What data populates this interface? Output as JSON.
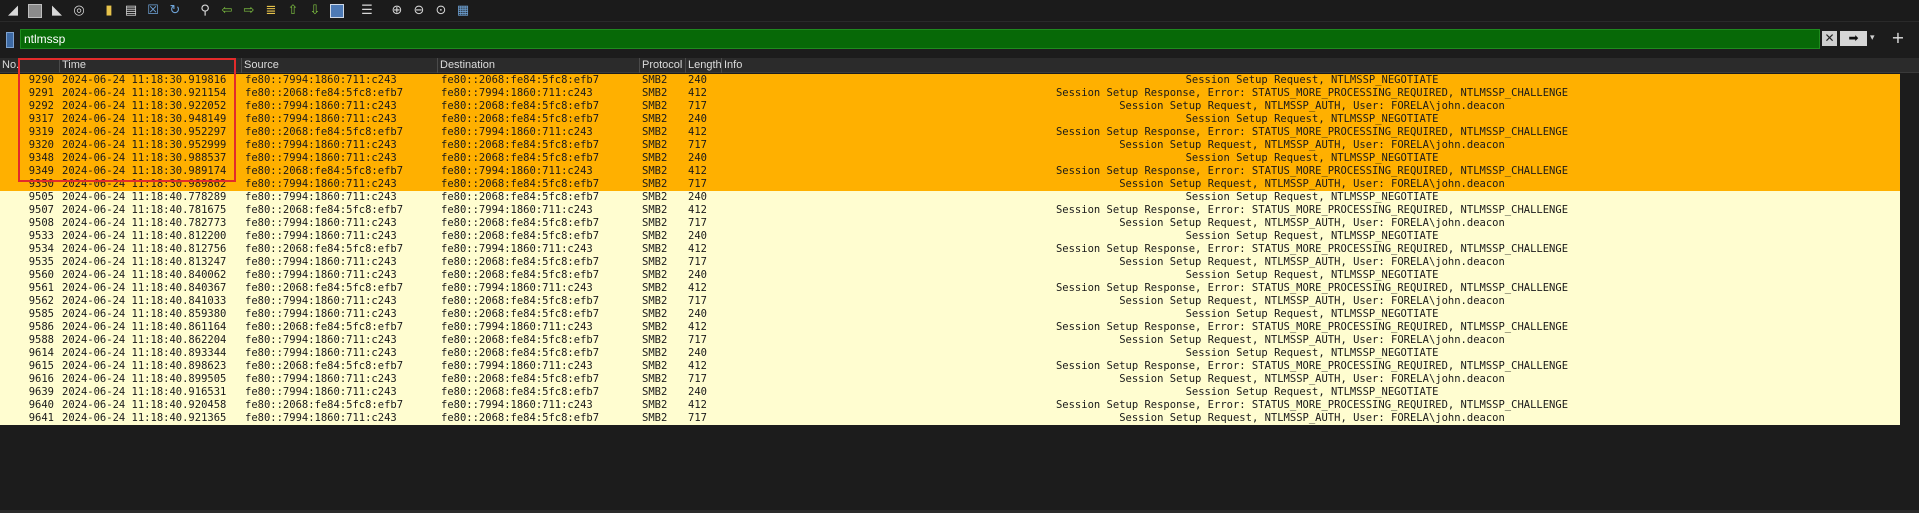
{
  "toolbar": {
    "icons": [
      "shark-fin-icon",
      "stop-icon",
      "restart-icon",
      "options-icon",
      "open-file-icon",
      "save-file-icon",
      "close-file-icon",
      "reload-icon",
      "find-icon",
      "back-arrow-icon",
      "forward-arrow-icon",
      "go-to-packet-icon",
      "first-packet-icon",
      "last-packet-icon",
      "autoscroll-icon",
      "colorize-icon",
      "zoom-in-icon",
      "zoom-out-icon",
      "normal-size-icon",
      "resize-columns-icon"
    ]
  },
  "filter": {
    "value": "ntlmssp",
    "clear_glyph": "✕",
    "apply_glyph": "➡",
    "dropdown_glyph": "▾",
    "add_glyph": "+"
  },
  "columns": {
    "no": "No.",
    "time": "Time",
    "source": "Source",
    "destination": "Destination",
    "protocol": "Protocol",
    "length": "Length",
    "info": "Info"
  },
  "colors": {
    "highlight_row": "#ffb000",
    "normal_row": "#fffdd0",
    "filter_bg": "#076907",
    "annotation_box": "#e22b2b"
  },
  "packets": [
    {
      "no": "9290",
      "time": "2024-06-24 11:18:30.919816",
      "src": "fe80::7994:1860:711:c243",
      "dst": "fe80::2068:fe84:5fc8:efb7",
      "proto": "SMB2",
      "len": "240",
      "info": "Session Setup Request, NTLMSSP_NEGOTIATE",
      "hl": true
    },
    {
      "no": "9291",
      "time": "2024-06-24 11:18:30.921154",
      "src": "fe80::2068:fe84:5fc8:efb7",
      "dst": "fe80::7994:1860:711:c243",
      "proto": "SMB2",
      "len": "412",
      "info": "Session Setup Response, Error: STATUS_MORE_PROCESSING_REQUIRED, NTLMSSP_CHALLENGE",
      "hl": true
    },
    {
      "no": "9292",
      "time": "2024-06-24 11:18:30.922052",
      "src": "fe80::7994:1860:711:c243",
      "dst": "fe80::2068:fe84:5fc8:efb7",
      "proto": "SMB2",
      "len": "717",
      "info": "Session Setup Request, NTLMSSP_AUTH, User: FORELA\\john.deacon",
      "hl": true
    },
    {
      "no": "9317",
      "time": "2024-06-24 11:18:30.948149",
      "src": "fe80::7994:1860:711:c243",
      "dst": "fe80::2068:fe84:5fc8:efb7",
      "proto": "SMB2",
      "len": "240",
      "info": "Session Setup Request, NTLMSSP_NEGOTIATE",
      "hl": true
    },
    {
      "no": "9319",
      "time": "2024-06-24 11:18:30.952297",
      "src": "fe80::2068:fe84:5fc8:efb7",
      "dst": "fe80::7994:1860:711:c243",
      "proto": "SMB2",
      "len": "412",
      "info": "Session Setup Response, Error: STATUS_MORE_PROCESSING_REQUIRED, NTLMSSP_CHALLENGE",
      "hl": true
    },
    {
      "no": "9320",
      "time": "2024-06-24 11:18:30.952999",
      "src": "fe80::7994:1860:711:c243",
      "dst": "fe80::2068:fe84:5fc8:efb7",
      "proto": "SMB2",
      "len": "717",
      "info": "Session Setup Request, NTLMSSP_AUTH, User: FORELA\\john.deacon",
      "hl": true
    },
    {
      "no": "9348",
      "time": "2024-06-24 11:18:30.988537",
      "src": "fe80::7994:1860:711:c243",
      "dst": "fe80::2068:fe84:5fc8:efb7",
      "proto": "SMB2",
      "len": "240",
      "info": "Session Setup Request, NTLMSSP_NEGOTIATE",
      "hl": true
    },
    {
      "no": "9349",
      "time": "2024-06-24 11:18:30.989174",
      "src": "fe80::2068:fe84:5fc8:efb7",
      "dst": "fe80::7994:1860:711:c243",
      "proto": "SMB2",
      "len": "412",
      "info": "Session Setup Response, Error: STATUS_MORE_PROCESSING_REQUIRED, NTLMSSP_CHALLENGE",
      "hl": true
    },
    {
      "no": "9350",
      "time": "2024-06-24 11:18:30.989862",
      "src": "fe80::7994:1860:711:c243",
      "dst": "fe80::2068:fe84:5fc8:efb7",
      "proto": "SMB2",
      "len": "717",
      "info": "Session Setup Request, NTLMSSP_AUTH, User: FORELA\\john.deacon",
      "hl": true
    },
    {
      "no": "9505",
      "time": "2024-06-24 11:18:40.778289",
      "src": "fe80::7994:1860:711:c243",
      "dst": "fe80::2068:fe84:5fc8:efb7",
      "proto": "SMB2",
      "len": "240",
      "info": "Session Setup Request, NTLMSSP_NEGOTIATE",
      "hl": false
    },
    {
      "no": "9507",
      "time": "2024-06-24 11:18:40.781675",
      "src": "fe80::2068:fe84:5fc8:efb7",
      "dst": "fe80::7994:1860:711:c243",
      "proto": "SMB2",
      "len": "412",
      "info": "Session Setup Response, Error: STATUS_MORE_PROCESSING_REQUIRED, NTLMSSP_CHALLENGE",
      "hl": false
    },
    {
      "no": "9508",
      "time": "2024-06-24 11:18:40.782773",
      "src": "fe80::7994:1860:711:c243",
      "dst": "fe80::2068:fe84:5fc8:efb7",
      "proto": "SMB2",
      "len": "717",
      "info": "Session Setup Request, NTLMSSP_AUTH, User: FORELA\\john.deacon",
      "hl": false
    },
    {
      "no": "9533",
      "time": "2024-06-24 11:18:40.812200",
      "src": "fe80::7994:1860:711:c243",
      "dst": "fe80::2068:fe84:5fc8:efb7",
      "proto": "SMB2",
      "len": "240",
      "info": "Session Setup Request, NTLMSSP_NEGOTIATE",
      "hl": false
    },
    {
      "no": "9534",
      "time": "2024-06-24 11:18:40.812756",
      "src": "fe80::2068:fe84:5fc8:efb7",
      "dst": "fe80::7994:1860:711:c243",
      "proto": "SMB2",
      "len": "412",
      "info": "Session Setup Response, Error: STATUS_MORE_PROCESSING_REQUIRED, NTLMSSP_CHALLENGE",
      "hl": false
    },
    {
      "no": "9535",
      "time": "2024-06-24 11:18:40.813247",
      "src": "fe80::7994:1860:711:c243",
      "dst": "fe80::2068:fe84:5fc8:efb7",
      "proto": "SMB2",
      "len": "717",
      "info": "Session Setup Request, NTLMSSP_AUTH, User: FORELA\\john.deacon",
      "hl": false
    },
    {
      "no": "9560",
      "time": "2024-06-24 11:18:40.840062",
      "src": "fe80::7994:1860:711:c243",
      "dst": "fe80::2068:fe84:5fc8:efb7",
      "proto": "SMB2",
      "len": "240",
      "info": "Session Setup Request, NTLMSSP_NEGOTIATE",
      "hl": false
    },
    {
      "no": "9561",
      "time": "2024-06-24 11:18:40.840367",
      "src": "fe80::2068:fe84:5fc8:efb7",
      "dst": "fe80::7994:1860:711:c243",
      "proto": "SMB2",
      "len": "412",
      "info": "Session Setup Response, Error: STATUS_MORE_PROCESSING_REQUIRED, NTLMSSP_CHALLENGE",
      "hl": false
    },
    {
      "no": "9562",
      "time": "2024-06-24 11:18:40.841033",
      "src": "fe80::7994:1860:711:c243",
      "dst": "fe80::2068:fe84:5fc8:efb7",
      "proto": "SMB2",
      "len": "717",
      "info": "Session Setup Request, NTLMSSP_AUTH, User: FORELA\\john.deacon",
      "hl": false
    },
    {
      "no": "9585",
      "time": "2024-06-24 11:18:40.859380",
      "src": "fe80::7994:1860:711:c243",
      "dst": "fe80::2068:fe84:5fc8:efb7",
      "proto": "SMB2",
      "len": "240",
      "info": "Session Setup Request, NTLMSSP_NEGOTIATE",
      "hl": false
    },
    {
      "no": "9586",
      "time": "2024-06-24 11:18:40.861164",
      "src": "fe80::2068:fe84:5fc8:efb7",
      "dst": "fe80::7994:1860:711:c243",
      "proto": "SMB2",
      "len": "412",
      "info": "Session Setup Response, Error: STATUS_MORE_PROCESSING_REQUIRED, NTLMSSP_CHALLENGE",
      "hl": false
    },
    {
      "no": "9588",
      "time": "2024-06-24 11:18:40.862204",
      "src": "fe80::7994:1860:711:c243",
      "dst": "fe80::2068:fe84:5fc8:efb7",
      "proto": "SMB2",
      "len": "717",
      "info": "Session Setup Request, NTLMSSP_AUTH, User: FORELA\\john.deacon",
      "hl": false
    },
    {
      "no": "9614",
      "time": "2024-06-24 11:18:40.893344",
      "src": "fe80::7994:1860:711:c243",
      "dst": "fe80::2068:fe84:5fc8:efb7",
      "proto": "SMB2",
      "len": "240",
      "info": "Session Setup Request, NTLMSSP_NEGOTIATE",
      "hl": false
    },
    {
      "no": "9615",
      "time": "2024-06-24 11:18:40.898623",
      "src": "fe80::2068:fe84:5fc8:efb7",
      "dst": "fe80::7994:1860:711:c243",
      "proto": "SMB2",
      "len": "412",
      "info": "Session Setup Response, Error: STATUS_MORE_PROCESSING_REQUIRED, NTLMSSP_CHALLENGE",
      "hl": false
    },
    {
      "no": "9616",
      "time": "2024-06-24 11:18:40.899505",
      "src": "fe80::7994:1860:711:c243",
      "dst": "fe80::2068:fe84:5fc8:efb7",
      "proto": "SMB2",
      "len": "717",
      "info": "Session Setup Request, NTLMSSP_AUTH, User: FORELA\\john.deacon",
      "hl": false
    },
    {
      "no": "9639",
      "time": "2024-06-24 11:18:40.916531",
      "src": "fe80::7994:1860:711:c243",
      "dst": "fe80::2068:fe84:5fc8:efb7",
      "proto": "SMB2",
      "len": "240",
      "info": "Session Setup Request, NTLMSSP_NEGOTIATE",
      "hl": false
    },
    {
      "no": "9640",
      "time": "2024-06-24 11:18:40.920458",
      "src": "fe80::2068:fe84:5fc8:efb7",
      "dst": "fe80::7994:1860:711:c243",
      "proto": "SMB2",
      "len": "412",
      "info": "Session Setup Response, Error: STATUS_MORE_PROCESSING_REQUIRED, NTLMSSP_CHALLENGE",
      "hl": false
    },
    {
      "no": "9641",
      "time": "2024-06-24 11:18:40.921365",
      "src": "fe80::7994:1860:711:c243",
      "dst": "fe80::2068:fe84:5fc8:efb7",
      "proto": "SMB2",
      "len": "717",
      "info": "Session Setup Request, NTLMSSP_AUTH, User: FORELA\\john.deacon",
      "hl": false
    }
  ]
}
